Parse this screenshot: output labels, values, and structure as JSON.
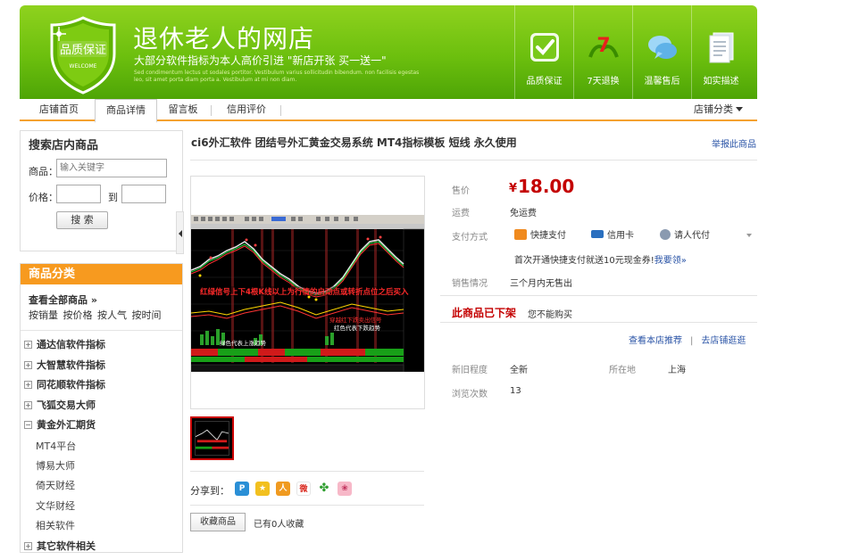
{
  "banner": {
    "badge_text": "品质保证",
    "badge_sub": "WELCOME",
    "title": "退休老人的网店",
    "slogan": "大部分软件指标为本人高价引进 \"新店开张 买一送一\"",
    "fine_print": "Sed condimentum lectus ut sodales portitor. Vestibulum varius sollicitudin bibendum. non facilisis egestas leo, sit amet porta diam porta a. Vestibulum at mi non diam.",
    "promises": [
      {
        "label": "品质保证",
        "icon": "check-icon",
        "color": "#ffffff"
      },
      {
        "label": "7天退换",
        "icon": "seven-day-icon",
        "color": "#e8201e"
      },
      {
        "label": "温馨售后",
        "icon": "chat-bubble-icon",
        "color": "#7ac2f0"
      },
      {
        "label": "如实描述",
        "icon": "document-icon",
        "color": "#ffffff"
      }
    ]
  },
  "nav": {
    "tabs": [
      "店铺首页",
      "商品详情",
      "留言板",
      "信用评价"
    ],
    "active_index": 1,
    "category": "店铺分类"
  },
  "search": {
    "title": "搜索店内商品",
    "product_label": "商品：",
    "product_placeholder": "输入关键字",
    "price_label": "价格：",
    "to_label": "到",
    "button": "搜 索"
  },
  "categories": {
    "title": "商品分类",
    "view_all": "查看全部商品 »",
    "sorts": "按销量 按价格 按人气 按时间",
    "items": [
      {
        "label": "通达信软件指标",
        "sign": "+"
      },
      {
        "label": "大智慧软件指标",
        "sign": "+"
      },
      {
        "label": "同花顺软件指标",
        "sign": "+"
      },
      {
        "label": "飞狐交易大师",
        "sign": "+"
      },
      {
        "label": "黄金外汇期货",
        "sign": "−"
      }
    ],
    "subitems": [
      "MT4平台",
      "博易大师",
      "倚天财经",
      "文华财经",
      "相关软件"
    ],
    "last_item": {
      "label": "其它软件相关",
      "sign": "+"
    }
  },
  "product": {
    "title": "ci6外汇软件 团结号外汇黄金交易系统  MT4指标模板  短线  永久使用",
    "report": "举报此商品",
    "share_label": "分享到：",
    "fav_button": "收藏商品",
    "fav_count": "已有0人收藏"
  },
  "chart_caption": {
    "banner_text": "红绿信号上下4根K线以上为行情的启动点或转折点位之后买入",
    "label_red": "红色代表下跌趋势",
    "label_green": "绿色代表上涨趋势",
    "label_sell": "穿越红下跌卖出信号"
  },
  "info": {
    "price_label": "售价",
    "price_symbol": "¥",
    "price": "18.00",
    "shipping_label": "运费",
    "shipping": "免运费",
    "payment_label": "支付方式",
    "payments": [
      "快捷支付",
      "信用卡",
      "请人代付"
    ],
    "pay_note": "首次开通快捷支付就送10元现金券!",
    "pay_note_link": "我要领»",
    "sales_label": "销售情况",
    "sales": "三个月内无售出",
    "offshelf": "此商品已下架",
    "offshelf_note": "您不能购买",
    "link_recommend": "查看本店推荐",
    "link_sep": "|",
    "link_shop": "去店铺逛逛",
    "condition_label": "新旧程度",
    "condition": "全新",
    "location_label": "所在地",
    "location": "上海",
    "views_label": "浏览次数",
    "views": "13"
  }
}
